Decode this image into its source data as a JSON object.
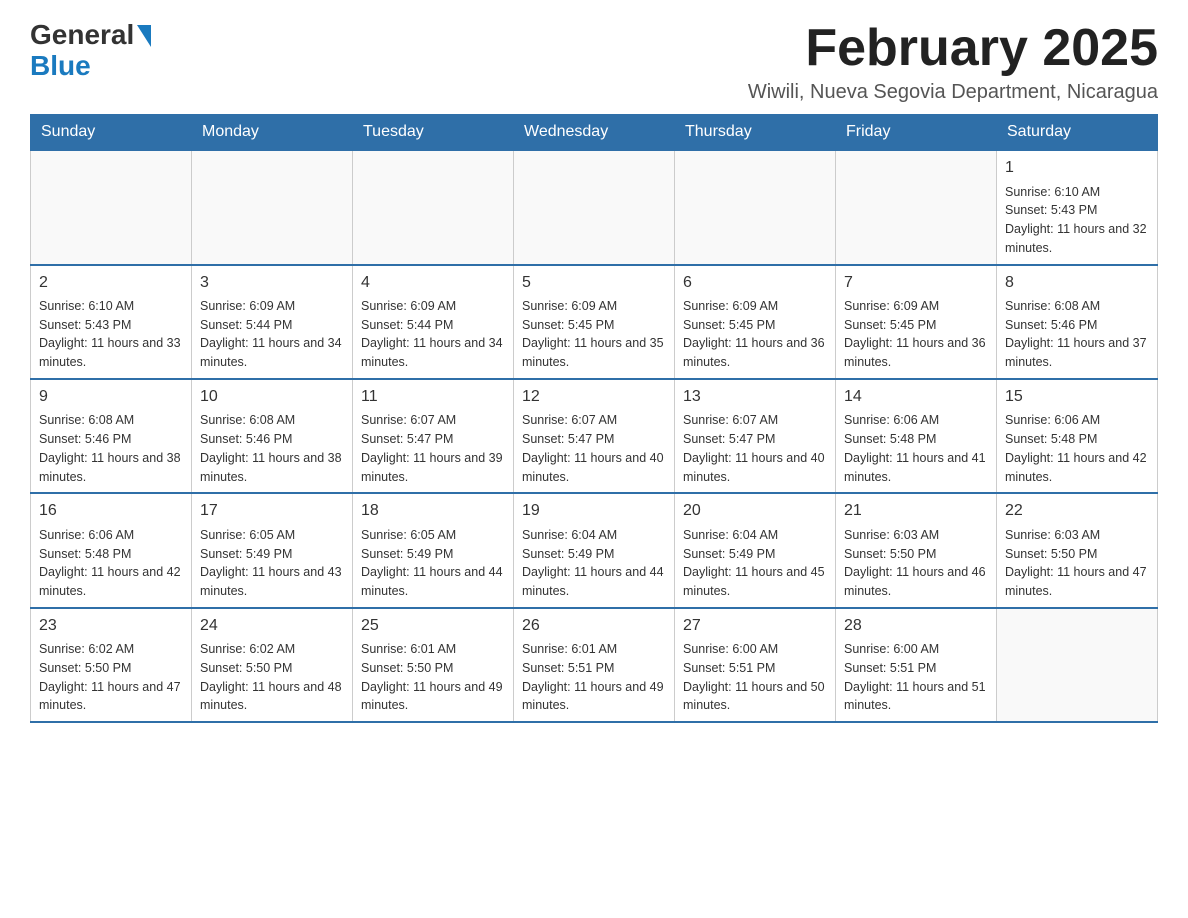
{
  "header": {
    "logo": {
      "general": "General",
      "blue": "Blue"
    },
    "title": "February 2025",
    "location": "Wiwili, Nueva Segovia Department, Nicaragua"
  },
  "calendar": {
    "days_of_week": [
      "Sunday",
      "Monday",
      "Tuesday",
      "Wednesday",
      "Thursday",
      "Friday",
      "Saturday"
    ],
    "weeks": [
      [
        {
          "day": "",
          "info": ""
        },
        {
          "day": "",
          "info": ""
        },
        {
          "day": "",
          "info": ""
        },
        {
          "day": "",
          "info": ""
        },
        {
          "day": "",
          "info": ""
        },
        {
          "day": "",
          "info": ""
        },
        {
          "day": "1",
          "info": "Sunrise: 6:10 AM\nSunset: 5:43 PM\nDaylight: 11 hours and 32 minutes."
        }
      ],
      [
        {
          "day": "2",
          "info": "Sunrise: 6:10 AM\nSunset: 5:43 PM\nDaylight: 11 hours and 33 minutes."
        },
        {
          "day": "3",
          "info": "Sunrise: 6:09 AM\nSunset: 5:44 PM\nDaylight: 11 hours and 34 minutes."
        },
        {
          "day": "4",
          "info": "Sunrise: 6:09 AM\nSunset: 5:44 PM\nDaylight: 11 hours and 34 minutes."
        },
        {
          "day": "5",
          "info": "Sunrise: 6:09 AM\nSunset: 5:45 PM\nDaylight: 11 hours and 35 minutes."
        },
        {
          "day": "6",
          "info": "Sunrise: 6:09 AM\nSunset: 5:45 PM\nDaylight: 11 hours and 36 minutes."
        },
        {
          "day": "7",
          "info": "Sunrise: 6:09 AM\nSunset: 5:45 PM\nDaylight: 11 hours and 36 minutes."
        },
        {
          "day": "8",
          "info": "Sunrise: 6:08 AM\nSunset: 5:46 PM\nDaylight: 11 hours and 37 minutes."
        }
      ],
      [
        {
          "day": "9",
          "info": "Sunrise: 6:08 AM\nSunset: 5:46 PM\nDaylight: 11 hours and 38 minutes."
        },
        {
          "day": "10",
          "info": "Sunrise: 6:08 AM\nSunset: 5:46 PM\nDaylight: 11 hours and 38 minutes."
        },
        {
          "day": "11",
          "info": "Sunrise: 6:07 AM\nSunset: 5:47 PM\nDaylight: 11 hours and 39 minutes."
        },
        {
          "day": "12",
          "info": "Sunrise: 6:07 AM\nSunset: 5:47 PM\nDaylight: 11 hours and 40 minutes."
        },
        {
          "day": "13",
          "info": "Sunrise: 6:07 AM\nSunset: 5:47 PM\nDaylight: 11 hours and 40 minutes."
        },
        {
          "day": "14",
          "info": "Sunrise: 6:06 AM\nSunset: 5:48 PM\nDaylight: 11 hours and 41 minutes."
        },
        {
          "day": "15",
          "info": "Sunrise: 6:06 AM\nSunset: 5:48 PM\nDaylight: 11 hours and 42 minutes."
        }
      ],
      [
        {
          "day": "16",
          "info": "Sunrise: 6:06 AM\nSunset: 5:48 PM\nDaylight: 11 hours and 42 minutes."
        },
        {
          "day": "17",
          "info": "Sunrise: 6:05 AM\nSunset: 5:49 PM\nDaylight: 11 hours and 43 minutes."
        },
        {
          "day": "18",
          "info": "Sunrise: 6:05 AM\nSunset: 5:49 PM\nDaylight: 11 hours and 44 minutes."
        },
        {
          "day": "19",
          "info": "Sunrise: 6:04 AM\nSunset: 5:49 PM\nDaylight: 11 hours and 44 minutes."
        },
        {
          "day": "20",
          "info": "Sunrise: 6:04 AM\nSunset: 5:49 PM\nDaylight: 11 hours and 45 minutes."
        },
        {
          "day": "21",
          "info": "Sunrise: 6:03 AM\nSunset: 5:50 PM\nDaylight: 11 hours and 46 minutes."
        },
        {
          "day": "22",
          "info": "Sunrise: 6:03 AM\nSunset: 5:50 PM\nDaylight: 11 hours and 47 minutes."
        }
      ],
      [
        {
          "day": "23",
          "info": "Sunrise: 6:02 AM\nSunset: 5:50 PM\nDaylight: 11 hours and 47 minutes."
        },
        {
          "day": "24",
          "info": "Sunrise: 6:02 AM\nSunset: 5:50 PM\nDaylight: 11 hours and 48 minutes."
        },
        {
          "day": "25",
          "info": "Sunrise: 6:01 AM\nSunset: 5:50 PM\nDaylight: 11 hours and 49 minutes."
        },
        {
          "day": "26",
          "info": "Sunrise: 6:01 AM\nSunset: 5:51 PM\nDaylight: 11 hours and 49 minutes."
        },
        {
          "day": "27",
          "info": "Sunrise: 6:00 AM\nSunset: 5:51 PM\nDaylight: 11 hours and 50 minutes."
        },
        {
          "day": "28",
          "info": "Sunrise: 6:00 AM\nSunset: 5:51 PM\nDaylight: 11 hours and 51 minutes."
        },
        {
          "day": "",
          "info": ""
        }
      ]
    ]
  }
}
